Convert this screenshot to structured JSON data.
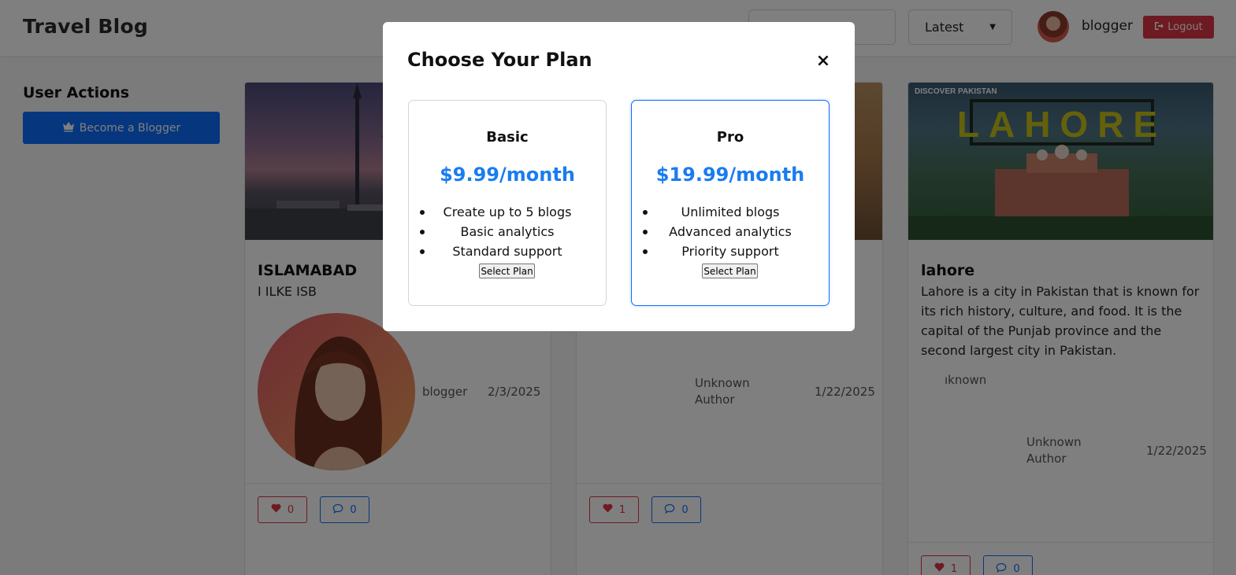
{
  "navbar": {
    "brand": "Travel Blog",
    "search_placeholder": "",
    "sort_value": "Latest",
    "username": "blogger",
    "logout_label": "Logout"
  },
  "sidebar": {
    "title": "User Actions",
    "become_blogger_label": "Become a Blogger"
  },
  "cards": [
    {
      "title": "ISLAMABAD",
      "text": "I ILKE ISB",
      "author": "blogger",
      "date": "2/3/2025",
      "likes": "0",
      "comments": "0"
    },
    {
      "author": "Unknown Author",
      "date": "1/22/2025",
      "likes": "1",
      "comments": "0"
    },
    {
      "title": "lahore",
      "text": "Lahore is a city in Pakistan that is known for its rich history, culture, and food. It is the capital of the Punjab province and the second largest city in Pakistan.",
      "broken_image_alt": "ıknown",
      "author": "Unknown Author",
      "date": "1/22/2025",
      "likes": "1",
      "comments": "0",
      "image_texts": {
        "badge": "DISCOVER PAKISTAN",
        "city": "LAHORE"
      }
    }
  ],
  "modal": {
    "title": "Choose Your Plan",
    "close_label": "×",
    "plans": [
      {
        "name": "Basic",
        "price": "$9.99/month",
        "features": [
          "Create up to 5 blogs",
          "Basic analytics",
          "Standard support"
        ],
        "button": "Select Plan"
      },
      {
        "name": "Pro",
        "price": "$19.99/month",
        "features": [
          "Unlimited blogs",
          "Advanced analytics",
          "Priority support"
        ],
        "button": "Select Plan"
      }
    ]
  },
  "icons": {
    "logout": "sign-out-icon",
    "crown": "crown-icon",
    "heart": "heart-icon",
    "comment": "comment-icon",
    "close": "close-icon"
  },
  "colors": {
    "primary": "#0d6efd",
    "danger": "#dc3545",
    "price": "#1a7cf0"
  }
}
